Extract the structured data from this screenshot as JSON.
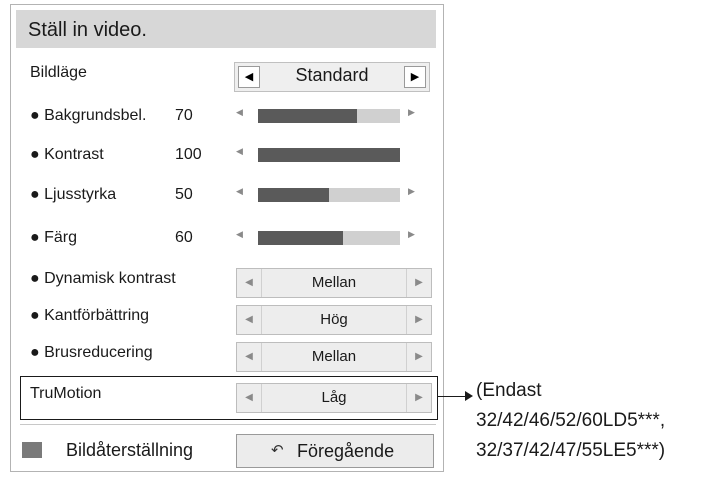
{
  "menu": {
    "title": "Ställ in video.",
    "picture_mode": {
      "label": "Bildläge",
      "value": "Standard"
    },
    "sliders": [
      {
        "label": "● Bakgrundsbel.",
        "value": "70",
        "fill_percent": 70
      },
      {
        "label": "● Kontrast",
        "value": "100",
        "fill_percent": 100
      },
      {
        "label": "● Ljusstyrka",
        "value": "50",
        "fill_percent": 50
      },
      {
        "label": "● Färg",
        "value": "60",
        "fill_percent": 60
      }
    ],
    "options": [
      {
        "label": "● Dynamisk kontrast",
        "value": "Mellan"
      },
      {
        "label": "● Kantförbättring",
        "value": "Hög"
      },
      {
        "label": "● Brusreducering",
        "value": "Mellan"
      },
      {
        "label": "TruMotion",
        "value": "Låg"
      }
    ],
    "reset_label": "Bildåterställning",
    "back_label": "Föregående"
  },
  "note": {
    "line1": "(Endast",
    "line2": "32/42/46/52/60LD5***,",
    "line3": "32/37/42/47/55LE5***)"
  }
}
